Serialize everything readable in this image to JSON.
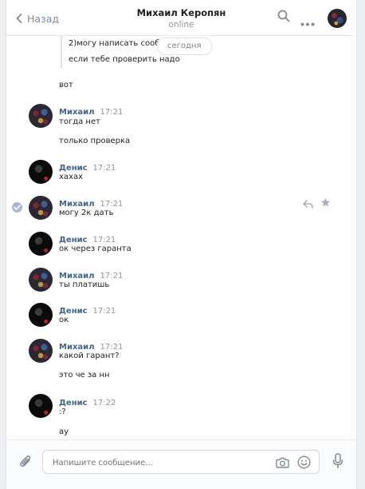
{
  "header": {
    "back_label": "Назад",
    "title": "Михаил Керопян",
    "status": "online"
  },
  "feed": {
    "quote_lines": [
      "2)могу написать сообщение от ге",
      "если тебе проверить надо"
    ],
    "date_pill": "сегодня",
    "standalone_top": "вот",
    "groups": [
      {
        "author": "Михаил",
        "time": "17:21",
        "messages": [
          "тогда нет",
          "только проверка"
        ]
      },
      {
        "author": "Денис",
        "time": "17:21",
        "messages": [
          "хахах"
        ]
      },
      {
        "author": "Михаил",
        "time": "17:21",
        "messages": [
          "могу 2к дать"
        ]
      },
      {
        "author": "Денис",
        "time": "17:21",
        "messages": [
          "ок через гаранта"
        ]
      },
      {
        "author": "Михаил",
        "time": "17:21",
        "messages": [
          "ты платишь"
        ]
      },
      {
        "author": "Денис",
        "time": "17:21",
        "messages": [
          "ок"
        ]
      },
      {
        "author": "Михаил",
        "time": "17:21",
        "messages": [
          "какой гарант?",
          "это че за нн"
        ]
      },
      {
        "author": "Денис",
        "time": "17:22",
        "messages": [
          ":?",
          "ау"
        ]
      }
    ]
  },
  "composer": {
    "placeholder": "Напишите сообщение..."
  },
  "icons": {
    "back": "chevron-left-icon",
    "search": "search-icon",
    "more": "more-dots-icon",
    "reply": "reply-icon",
    "favorite": "star-icon",
    "selected": "checkmark-icon",
    "attach": "paperclip-icon",
    "camera": "camera-icon",
    "emoji": "emoji-icon",
    "voice": "microphone-icon"
  },
  "colors": {
    "accent": "#42648b",
    "muted": "#939393",
    "background": "#edeef0"
  }
}
